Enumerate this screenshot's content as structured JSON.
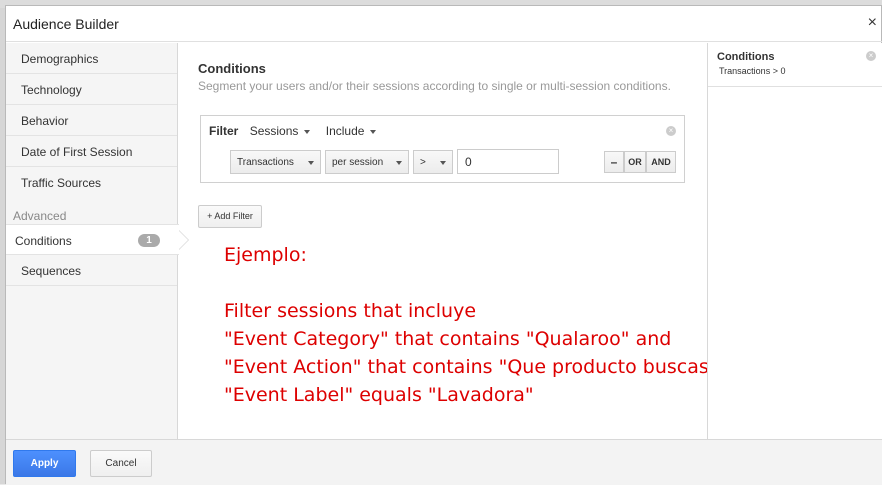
{
  "dialog": {
    "title": "Audience Builder",
    "close": "×"
  },
  "sidebar": {
    "items": [
      {
        "label": "Demographics"
      },
      {
        "label": "Technology"
      },
      {
        "label": "Behavior"
      },
      {
        "label": "Date of First Session"
      },
      {
        "label": "Traffic Sources"
      }
    ],
    "section": "Advanced",
    "advanced": [
      {
        "label": "Conditions",
        "badge": "1",
        "active": true
      },
      {
        "label": "Sequences"
      }
    ]
  },
  "main": {
    "title": "Conditions",
    "subtitle": "Segment your users and/or their sessions according to single or multi-session conditions.",
    "filter": {
      "label": "Filter",
      "scope": "Sessions",
      "mode": "Include",
      "remove": "×",
      "metric": "Transactions",
      "per": "per session",
      "operator": ">",
      "value": "0",
      "minus": "–",
      "or": "OR",
      "and": "AND"
    },
    "add_filter": "+ Add Filter"
  },
  "annotation": {
    "lines": [
      "Ejemplo:",
      "",
      "Filter sessions that incluye",
      "\"Event Category\" that contains \"Qualaroo\" and",
      "\"Event Action\" that contains \"Que producto buscas\" and",
      "\"Event Label\" equals \"Lavadora\""
    ],
    "color": "#dd0000"
  },
  "summary": {
    "title": "Conditions",
    "text": "Transactions > 0",
    "remove": "×"
  },
  "footer": {
    "apply": "Apply",
    "cancel": "Cancel"
  },
  "colors": {
    "accent": "#4d90fe",
    "annotation": "#dd0000"
  }
}
